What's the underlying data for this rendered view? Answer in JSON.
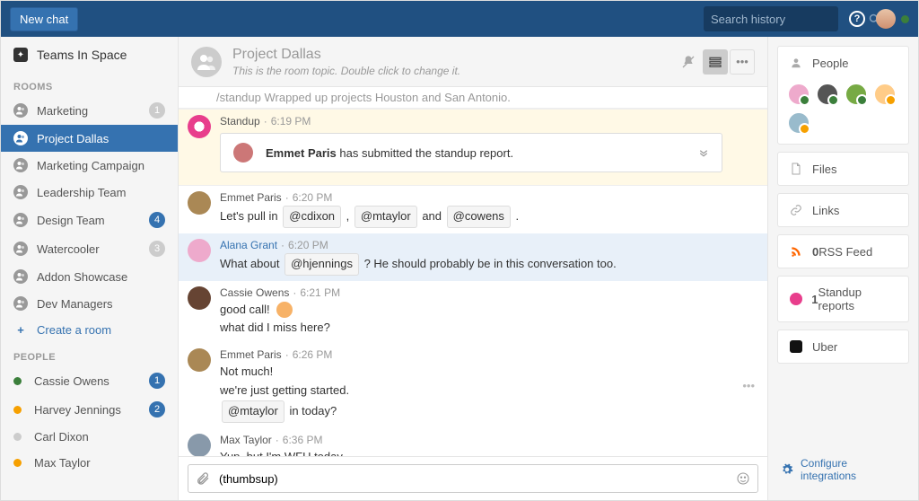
{
  "topbar": {
    "new_chat": "New chat",
    "search_placeholder": "Search history"
  },
  "workspace": {
    "name": "Teams In Space"
  },
  "sidebar": {
    "rooms_header": "ROOMS",
    "people_header": "PEOPLE",
    "rooms": [
      {
        "label": "Marketing",
        "badge": "1",
        "badge_blue": false,
        "active": false
      },
      {
        "label": "Project Dallas",
        "badge": "",
        "badge_blue": false,
        "active": true
      },
      {
        "label": "Marketing Campaign",
        "badge": "",
        "badge_blue": false,
        "active": false
      },
      {
        "label": "Leadership Team",
        "badge": "",
        "badge_blue": false,
        "active": false
      },
      {
        "label": "Design Team",
        "badge": "4",
        "badge_blue": true,
        "active": false
      },
      {
        "label": "Watercooler",
        "badge": "3",
        "badge_blue": false,
        "active": false
      },
      {
        "label": "Addon Showcase",
        "badge": "",
        "badge_blue": false,
        "active": false
      },
      {
        "label": "Dev Managers",
        "badge": "",
        "badge_blue": false,
        "active": false
      }
    ],
    "create_room": "Create a room",
    "people": [
      {
        "label": "Cassie Owens",
        "presence": "green",
        "badge": "1",
        "badge_blue": true
      },
      {
        "label": "Harvey Jennings",
        "presence": "orange",
        "badge": "2",
        "badge_blue": true
      },
      {
        "label": "Carl Dixon",
        "presence": "grey",
        "badge": "",
        "badge_blue": false
      },
      {
        "label": "Max Taylor",
        "presence": "orange",
        "badge": "",
        "badge_blue": false
      }
    ]
  },
  "chat": {
    "title": "Project Dallas",
    "topic": "This is the room topic. Double click to change it.",
    "cropped_line": "/standup Wrapped up projects Houston and San Antonio.",
    "standup": {
      "sender": "Standup",
      "time": "6:19 PM",
      "card_name": "Emmet Paris",
      "card_rest": " has submitted the standup report."
    },
    "m1": {
      "sender": "Emmet Paris",
      "time": "6:20 PM",
      "pre": "Let's pull in ",
      "chip1": "@cdixon",
      "sep1": " , ",
      "chip2": "@mtaylor",
      "sep2": " and ",
      "chip3": "@cowens",
      "post": " ."
    },
    "m2": {
      "sender": "Alana Grant",
      "time": "6:20 PM",
      "pre": "What about ",
      "chip": "@hjennings",
      "post": " ? He should probably be in this conversation too."
    },
    "m3": {
      "sender": "Cassie Owens",
      "time": "6:21 PM",
      "l1_pre": "good call! ",
      "l2": "what did I miss here?"
    },
    "m4": {
      "sender": "Emmet Paris",
      "time": "6:26 PM",
      "l1": "Not much!",
      "l2": "we're just getting started.",
      "l3_chip": "@mtaylor",
      "l3_post": " in today?"
    },
    "m5": {
      "sender": "Max Taylor",
      "time": "6:36 PM",
      "l1": "Yup, but I'm WFH today."
    },
    "composer_value": "(thumbsup)"
  },
  "right": {
    "people_header": "People",
    "files": "Files",
    "links": "Links",
    "rss_count": "0",
    "rss_label": " RSS Feed",
    "standup_count": "1",
    "standup_label": " Standup reports",
    "uber": "Uber",
    "configure": "Configure integrations"
  }
}
